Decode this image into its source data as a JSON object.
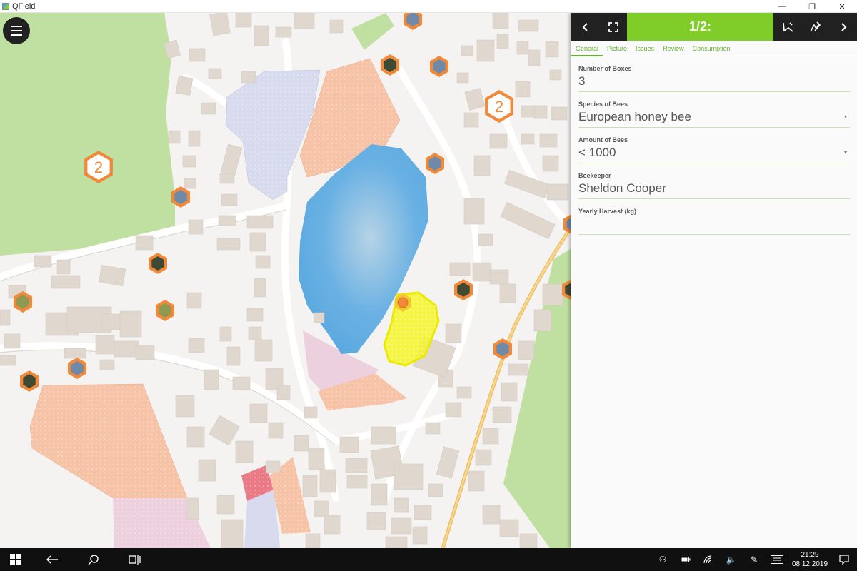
{
  "window": {
    "title": "QField",
    "minimize_icon": "minimize-icon",
    "restore_icon": "restore-icon",
    "close_icon": "close-icon"
  },
  "map": {
    "menu_icon": "hamburger-menu-icon",
    "cluster_labels": [
      "2",
      "2"
    ],
    "colors": {
      "forest": "#bfe0a1",
      "water": "#6ab1e3",
      "building": "#e0d8cf",
      "orange_area": "#f6c3a6",
      "blue_area": "#d8dbee",
      "pink_area": "#ecd0de",
      "red_area": "#e97a86",
      "road_main": "#f2c565",
      "marker_ring": "#f08a3a",
      "highlight": "#f4f42a"
    }
  },
  "panel": {
    "header": {
      "title": "1/2:",
      "back_icon": "chevron-left-icon",
      "fullscreen_icon": "fullscreen-icon",
      "digitize_icon": "edit-geometry-icon",
      "edit_icon": "edit-attributes-icon",
      "next_icon": "chevron-right-icon"
    },
    "tabs": [
      "General",
      "Picture",
      "Issues",
      "Review",
      "Consumption"
    ],
    "fields": [
      {
        "label": "Number of Boxes",
        "value": "3",
        "dropdown": false
      },
      {
        "label": "Species of Bees",
        "value": "European honey bee",
        "dropdown": true
      },
      {
        "label": "Amount of Bees",
        "value": "< 1000",
        "dropdown": true
      },
      {
        "label": "Beekeeper",
        "value": "Sheldon Cooper",
        "dropdown": false
      },
      {
        "label": "Yearly Harvest (kg)",
        "value": "",
        "dropdown": false
      }
    ]
  },
  "taskbar": {
    "start_icon": "windows-start-icon",
    "back_icon": "back-arrow-icon",
    "search_icon": "search-icon",
    "task_view_icon": "task-view-icon",
    "tray_icons": [
      "people-icon",
      "battery-icon",
      "wifi-icon",
      "volume-icon",
      "pen-icon",
      "keyboard-icon"
    ],
    "time": "21:29",
    "date": "08.12.2019",
    "notification_icon": "notification-icon"
  }
}
